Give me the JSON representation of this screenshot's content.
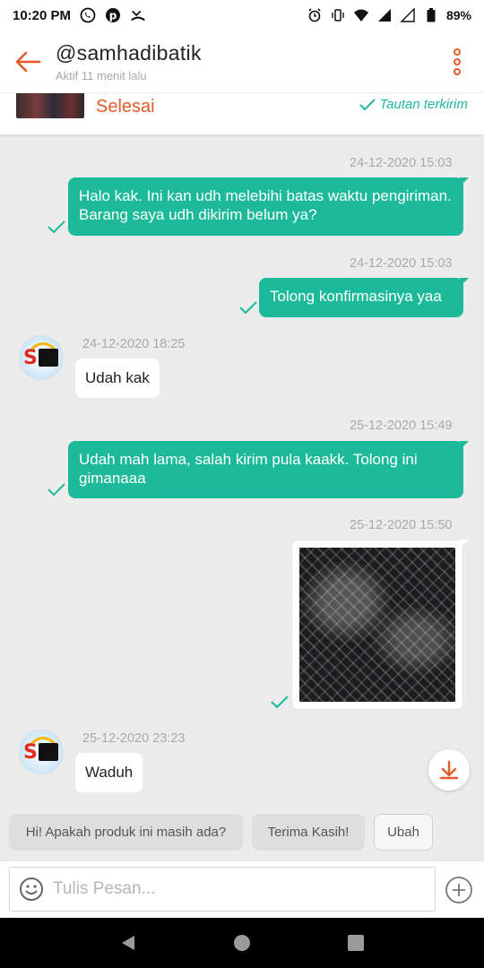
{
  "status_bar": {
    "time": "10:20 PM",
    "battery": "89%",
    "left_icons": [
      "whatsapp-icon",
      "pinterest-icon",
      "missed-call-icon"
    ],
    "right_icons": [
      "alarm-icon",
      "vibrate-icon",
      "wifi-icon",
      "signal-icon",
      "signal-empty-icon",
      "battery-icon"
    ]
  },
  "header": {
    "name": "@samhadibatik",
    "status": "Aktif 11 menit lalu"
  },
  "order": {
    "status": "Selesai",
    "link_text": "Tautan terkirim"
  },
  "messages": [
    {
      "side": "out",
      "time": "24-12-2020 15:03",
      "text": "Halo kak. Ini kan udh melebihi batas waktu pengiriman. Barang saya udh dikirim belum ya?"
    },
    {
      "side": "out",
      "time": "24-12-2020 15:03",
      "text": "Tolong konfirmasinya yaa"
    },
    {
      "side": "in",
      "time": "24-12-2020 18:25",
      "text": "Udah kak"
    },
    {
      "side": "out",
      "time": "25-12-2020 15:49",
      "text": "Udah mah lama, salah kirim pula kaakk. Tolong ini gimanaaa"
    },
    {
      "side": "out",
      "time": "25-12-2020 15:50",
      "type": "image"
    },
    {
      "side": "in",
      "time": "25-12-2020 23:23",
      "text": "Waduh"
    }
  ],
  "quick_replies": [
    "Hi! Apakah produk ini masih ada?",
    "Terima Kasih!",
    "Ubah"
  ],
  "composer": {
    "placeholder": "Tulis Pesan..."
  },
  "colors": {
    "accent": "#e35b2a",
    "bubble_out": "#1cb99a",
    "check": "#1cb99a"
  }
}
